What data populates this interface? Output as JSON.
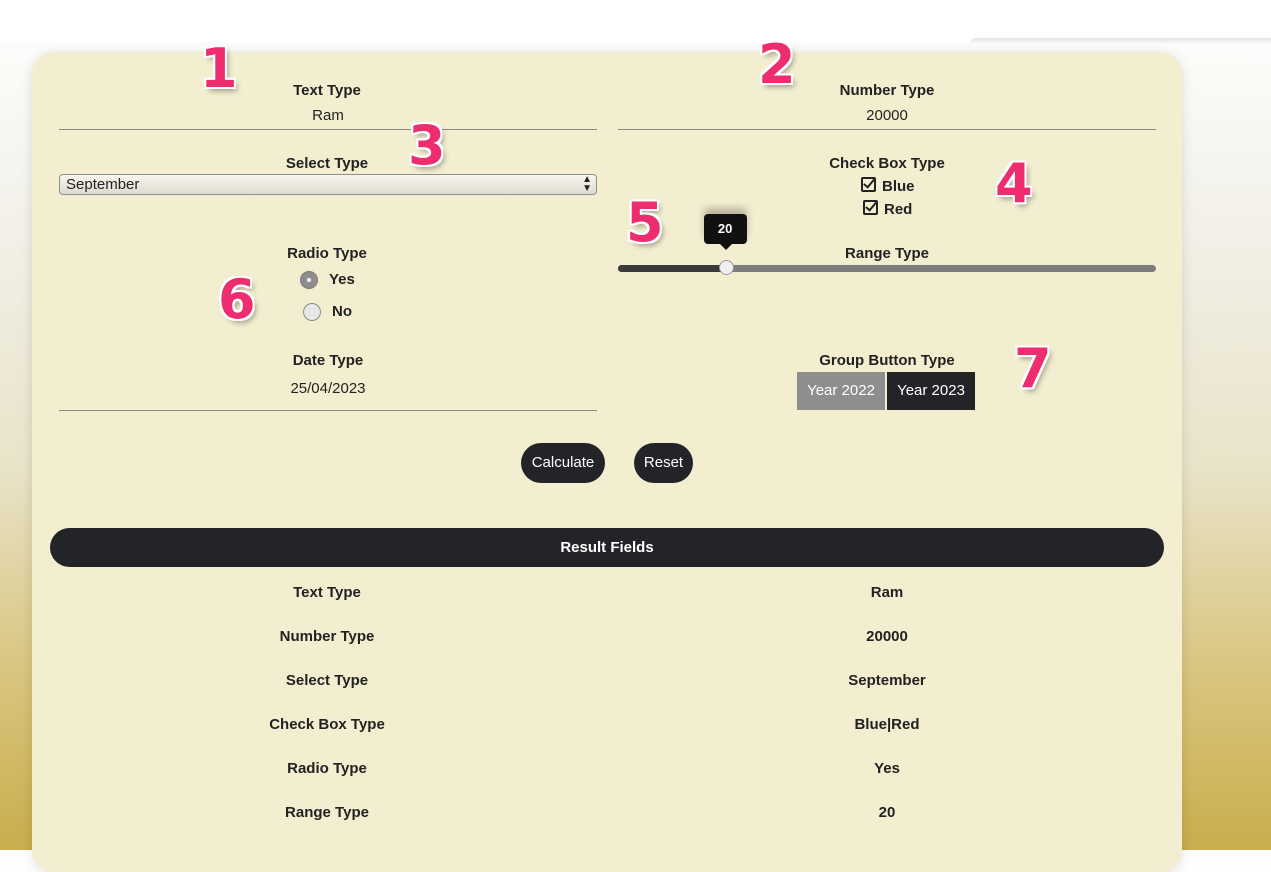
{
  "form": {
    "text_type": {
      "label": "Text Type",
      "value": "Ram"
    },
    "number_type": {
      "label": "Number Type",
      "value": "20000"
    },
    "select_type": {
      "label": "Select Type",
      "value": "September"
    },
    "checkbox_type": {
      "label": "Check Box Type",
      "options": [
        {
          "label": "Blue",
          "checked": true
        },
        {
          "label": "Red",
          "checked": true
        }
      ]
    },
    "radio_type": {
      "label": "Radio Type",
      "options": [
        {
          "label": "Yes",
          "selected": true
        },
        {
          "label": "No",
          "selected": false
        }
      ]
    },
    "range_type": {
      "label": "Range Type",
      "value": "20",
      "fraction": 0.2
    },
    "date_type": {
      "label": "Date Type",
      "value": "25/04/2023"
    },
    "group_button_type": {
      "label": "Group Button Type",
      "buttons": [
        {
          "label": "Year 2022",
          "active": false,
          "color": "#8e8e8e"
        },
        {
          "label": "Year 2023",
          "active": true,
          "color": "#222428"
        }
      ]
    }
  },
  "actions": {
    "calculate_label": "Calculate",
    "reset_label": "Reset"
  },
  "results": {
    "header": "Result Fields",
    "rows": [
      {
        "label": "Text Type",
        "value": "Ram"
      },
      {
        "label": "Number Type",
        "value": "20000"
      },
      {
        "label": "Select Type",
        "value": "September"
      },
      {
        "label": "Check Box Type",
        "value": "Blue|Red"
      },
      {
        "label": "Radio Type",
        "value": "Yes"
      },
      {
        "label": "Range Type",
        "value": "20"
      }
    ]
  },
  "annotations": [
    "1",
    "2",
    "3",
    "4",
    "5",
    "6",
    "7"
  ],
  "colors": {
    "card_bg": "#f4eed1",
    "dark": "#222428",
    "annotation": "#ee2d6e"
  }
}
